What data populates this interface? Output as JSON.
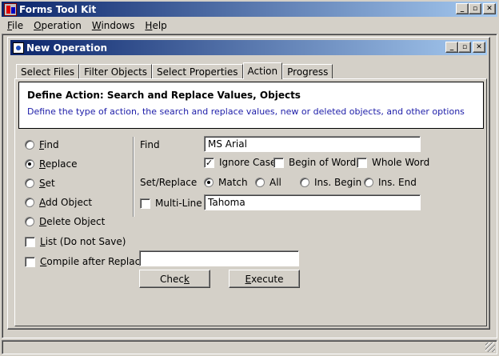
{
  "app": {
    "title": "Forms Tool Kit"
  },
  "menu": [
    {
      "pre": "",
      "key": "F",
      "post": "ile"
    },
    {
      "pre": "",
      "key": "O",
      "post": "peration"
    },
    {
      "pre": "",
      "key": "W",
      "post": "indows"
    },
    {
      "pre": "",
      "key": "H",
      "post": "elp"
    }
  ],
  "child": {
    "title": "New Operation"
  },
  "tabs": [
    "Select Files",
    "Filter Objects",
    "Select Properties",
    "Action",
    "Progress"
  ],
  "header": {
    "title": "Define Action: Search and Replace Values, Objects",
    "description": "Define the type of action, the search and replace values, new or deleted objects, and other options"
  },
  "actions": [
    {
      "key": "F",
      "rest": "ind",
      "selected": false
    },
    {
      "key": "R",
      "rest": "eplace",
      "selected": true
    },
    {
      "key": "S",
      "rest": "et",
      "selected": false
    },
    {
      "key": "A",
      "rest": "dd Object",
      "selected": false
    },
    {
      "key": "D",
      "rest": "elete Object",
      "selected": false
    }
  ],
  "options": {
    "list": {
      "key": "L",
      "rest": "ist (Do not Save)",
      "checked": false
    },
    "compile": {
      "key": "C",
      "rest": "ompile after Replace",
      "checked": false
    }
  },
  "find": {
    "label": "Find",
    "value": "MS Arial",
    "ignore_case": {
      "label": "Ignore Case.",
      "checked": true
    },
    "begin_of_word": {
      "label": "Begin of Word",
      "checked": false
    },
    "whole_word": {
      "label": "Whole Word",
      "checked": false
    }
  },
  "set_replace": {
    "label": "Set/Replace",
    "modes": [
      {
        "label": "Match",
        "selected": true
      },
      {
        "label": "All",
        "selected": false
      },
      {
        "label": "Ins. Begin",
        "selected": false
      },
      {
        "label": "Ins. End",
        "selected": false
      }
    ]
  },
  "multiline": {
    "label": "Multi-Line",
    "checked": false
  },
  "replace_value": "Tahoma",
  "compile_value": "",
  "buttons": {
    "check": {
      "key": "k",
      "pre": "Chec",
      "post": ""
    },
    "execute": {
      "key": "E",
      "pre": "",
      "post": "xecute"
    }
  }
}
